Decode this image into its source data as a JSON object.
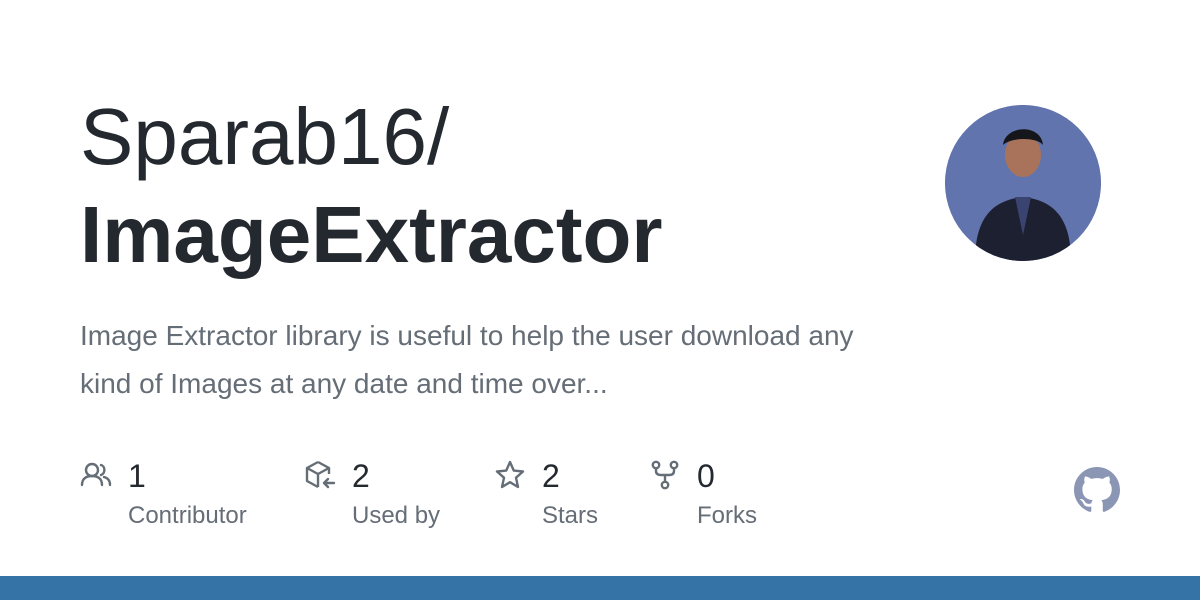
{
  "repo": {
    "owner": "Sparab16/",
    "name": "ImageExtractor",
    "description": "Image Extractor library is useful to help the user download any kind of Images at any date and time over..."
  },
  "stats": [
    {
      "icon": "people-icon",
      "value": "1",
      "label": "Contributor"
    },
    {
      "icon": "package-dependents-icon",
      "value": "2",
      "label": "Used by"
    },
    {
      "icon": "star-icon",
      "value": "2",
      "label": "Stars"
    },
    {
      "icon": "repo-forked-icon",
      "value": "0",
      "label": "Forks"
    }
  ],
  "colors": {
    "language_bar": "#3572a5",
    "title": "#24292f",
    "muted": "#656d76"
  }
}
